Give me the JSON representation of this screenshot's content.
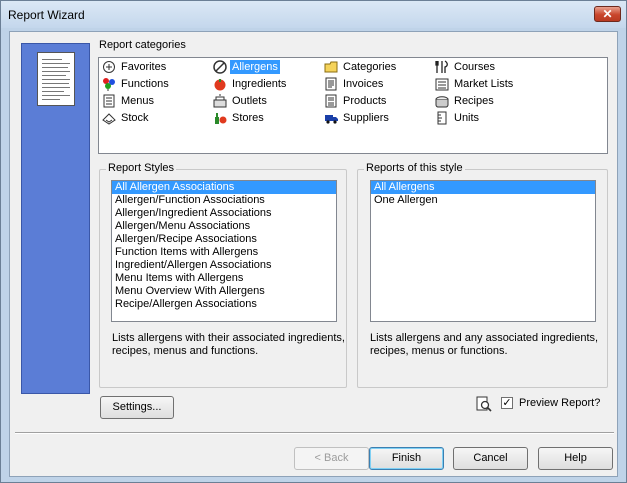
{
  "window": {
    "title": "Report Wizard"
  },
  "categories": {
    "label": "Report categories",
    "items": [
      {
        "label": "Favorites",
        "icon": "favorites-icon"
      },
      {
        "label": "Functions",
        "icon": "functions-icon"
      },
      {
        "label": "Menus",
        "icon": "menus-icon"
      },
      {
        "label": "Stock",
        "icon": "stock-icon"
      },
      {
        "label": "Allergens",
        "icon": "allergens-icon",
        "selected": true
      },
      {
        "label": "Ingredients",
        "icon": "ingredients-icon"
      },
      {
        "label": "Outlets",
        "icon": "outlets-icon"
      },
      {
        "label": "Stores",
        "icon": "stores-icon"
      },
      {
        "label": "Categories",
        "icon": "categories-icon"
      },
      {
        "label": "Invoices",
        "icon": "invoices-icon"
      },
      {
        "label": "Products",
        "icon": "products-icon"
      },
      {
        "label": "Suppliers",
        "icon": "suppliers-icon"
      },
      {
        "label": "Courses",
        "icon": "courses-icon"
      },
      {
        "label": "Market Lists",
        "icon": "market-lists-icon"
      },
      {
        "label": "Recipes",
        "icon": "recipes-icon"
      },
      {
        "label": "Units",
        "icon": "units-icon"
      }
    ]
  },
  "report_styles": {
    "label": "Report Styles",
    "items": [
      "All Allergen Associations",
      "Allergen/Function Associations",
      "Allergen/Ingredient Associations",
      "Allergen/Menu Associations",
      "Allergen/Recipe Associations",
      "Function Items with Allergens",
      "Ingredient/Allergen Associations",
      "Menu Items with Allergens",
      "Menu Overview With Allergens",
      "Recipe/Allergen Associations"
    ],
    "selected_index": 0,
    "description_line1": "Lists allergens with their associated ingredients,",
    "description_line2": "recipes, menus and functions."
  },
  "reports_of_style": {
    "label": "Reports of this style",
    "items": [
      "All Allergens",
      "One Allergen"
    ],
    "selected_index": 0,
    "description_line1": "Lists allergens and any associated ingredients,",
    "description_line2": "recipes, menus or functions."
  },
  "buttons": {
    "settings": "Settings...",
    "back": "< Back",
    "finish": "Finish",
    "cancel": "Cancel",
    "help": "Help"
  },
  "preview": {
    "label": "Preview Report?",
    "checked": true
  }
}
